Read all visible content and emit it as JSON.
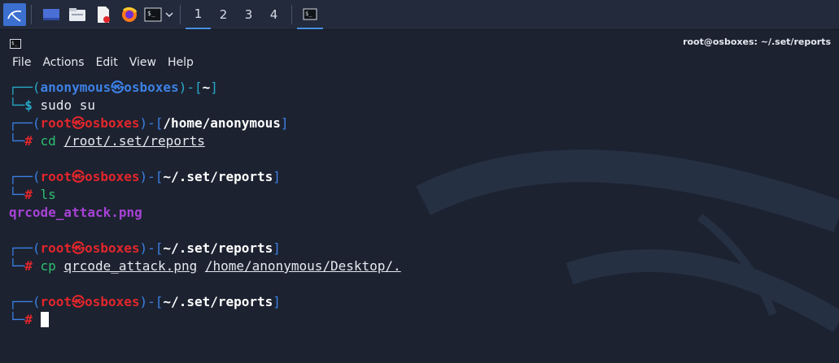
{
  "taskbar": {
    "workspaces": [
      "1",
      "2",
      "3",
      "4"
    ],
    "active_workspace": 0
  },
  "window": {
    "title": "root@osboxes: ~/.set/reports",
    "menu": [
      "File",
      "Actions",
      "Edit",
      "View",
      "Help"
    ]
  },
  "terminal": {
    "prompt1": {
      "user": "anonymous",
      "host": "osboxes",
      "path": "~",
      "symbol": "$",
      "cmd": "sudo su"
    },
    "prompt2": {
      "user": "root",
      "host": "osboxes",
      "path": "/home/anonymous",
      "symbol": "#",
      "cmd": "cd",
      "arg": "/root/.set/reports"
    },
    "prompt3": {
      "user": "root",
      "host": "osboxes",
      "path": "~/.set/reports",
      "symbol": "#",
      "cmd": "ls"
    },
    "output3": "qrcode_attack.png",
    "prompt4": {
      "user": "root",
      "host": "osboxes",
      "path": "~/.set/reports",
      "symbol": "#",
      "cmd": "cp",
      "arg1": "qrcode_attack.png",
      "arg2": "/home/anonymous/Desktop/."
    },
    "prompt5": {
      "user": "root",
      "host": "osboxes",
      "path": "~/.set/reports",
      "symbol": "#"
    }
  },
  "colors": {
    "prompt_frame": "#3d80e4",
    "root_user": "#e2262b",
    "command": "#2fbf71",
    "file_png": "#a742d6"
  }
}
